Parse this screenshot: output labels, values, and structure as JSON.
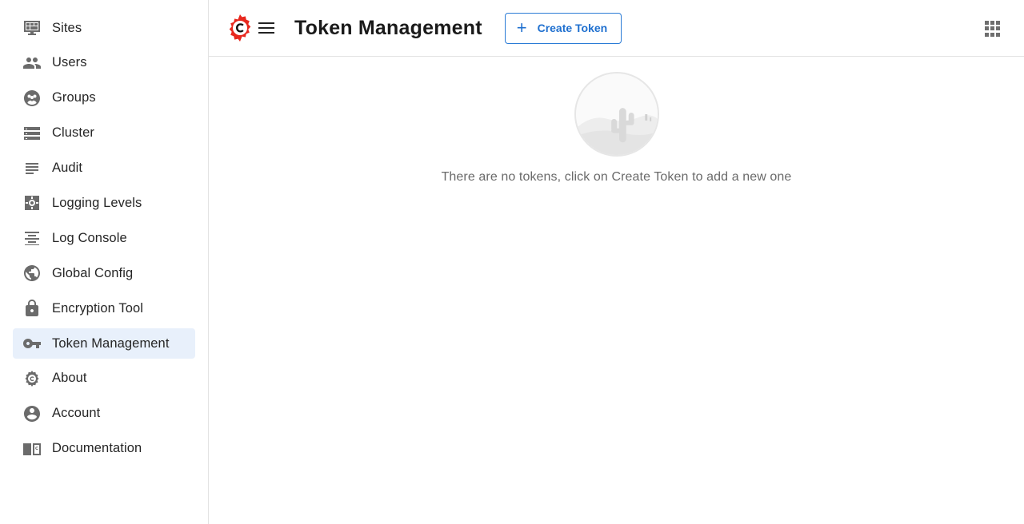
{
  "sidebar": {
    "items": [
      {
        "label": "Sites",
        "icon": "sites-icon"
      },
      {
        "label": "Users",
        "icon": "users-icon"
      },
      {
        "label": "Groups",
        "icon": "groups-icon"
      },
      {
        "label": "Cluster",
        "icon": "cluster-icon"
      },
      {
        "label": "Audit",
        "icon": "audit-icon"
      },
      {
        "label": "Logging Levels",
        "icon": "logging-levels-icon"
      },
      {
        "label": "Log Console",
        "icon": "log-console-icon"
      },
      {
        "label": "Global Config",
        "icon": "globe-icon"
      },
      {
        "label": "Encryption Tool",
        "icon": "lock-icon"
      },
      {
        "label": "Token Management",
        "icon": "key-icon",
        "active": true
      },
      {
        "label": "About",
        "icon": "crafter-gear-icon"
      },
      {
        "label": "Account",
        "icon": "account-icon"
      },
      {
        "label": "Documentation",
        "icon": "book-icon"
      }
    ]
  },
  "header": {
    "title": "Token Management",
    "create_button_label": "Create Token",
    "create_button_icon": "plus-icon",
    "apps_icon": "apps-grid-icon",
    "menu_icon": "hamburger-menu-icon",
    "logo_icon": "crafter-logo-icon"
  },
  "empty_state": {
    "message": "There are no tokens, click on Create Token to add a new one",
    "illustration": "cactus-desert-illustration"
  },
  "colors": {
    "accent": "#1e6fcf",
    "active_bg": "#e8f0fb",
    "logo_red": "#e8281e",
    "icon_gray": "#6b6b6b"
  }
}
